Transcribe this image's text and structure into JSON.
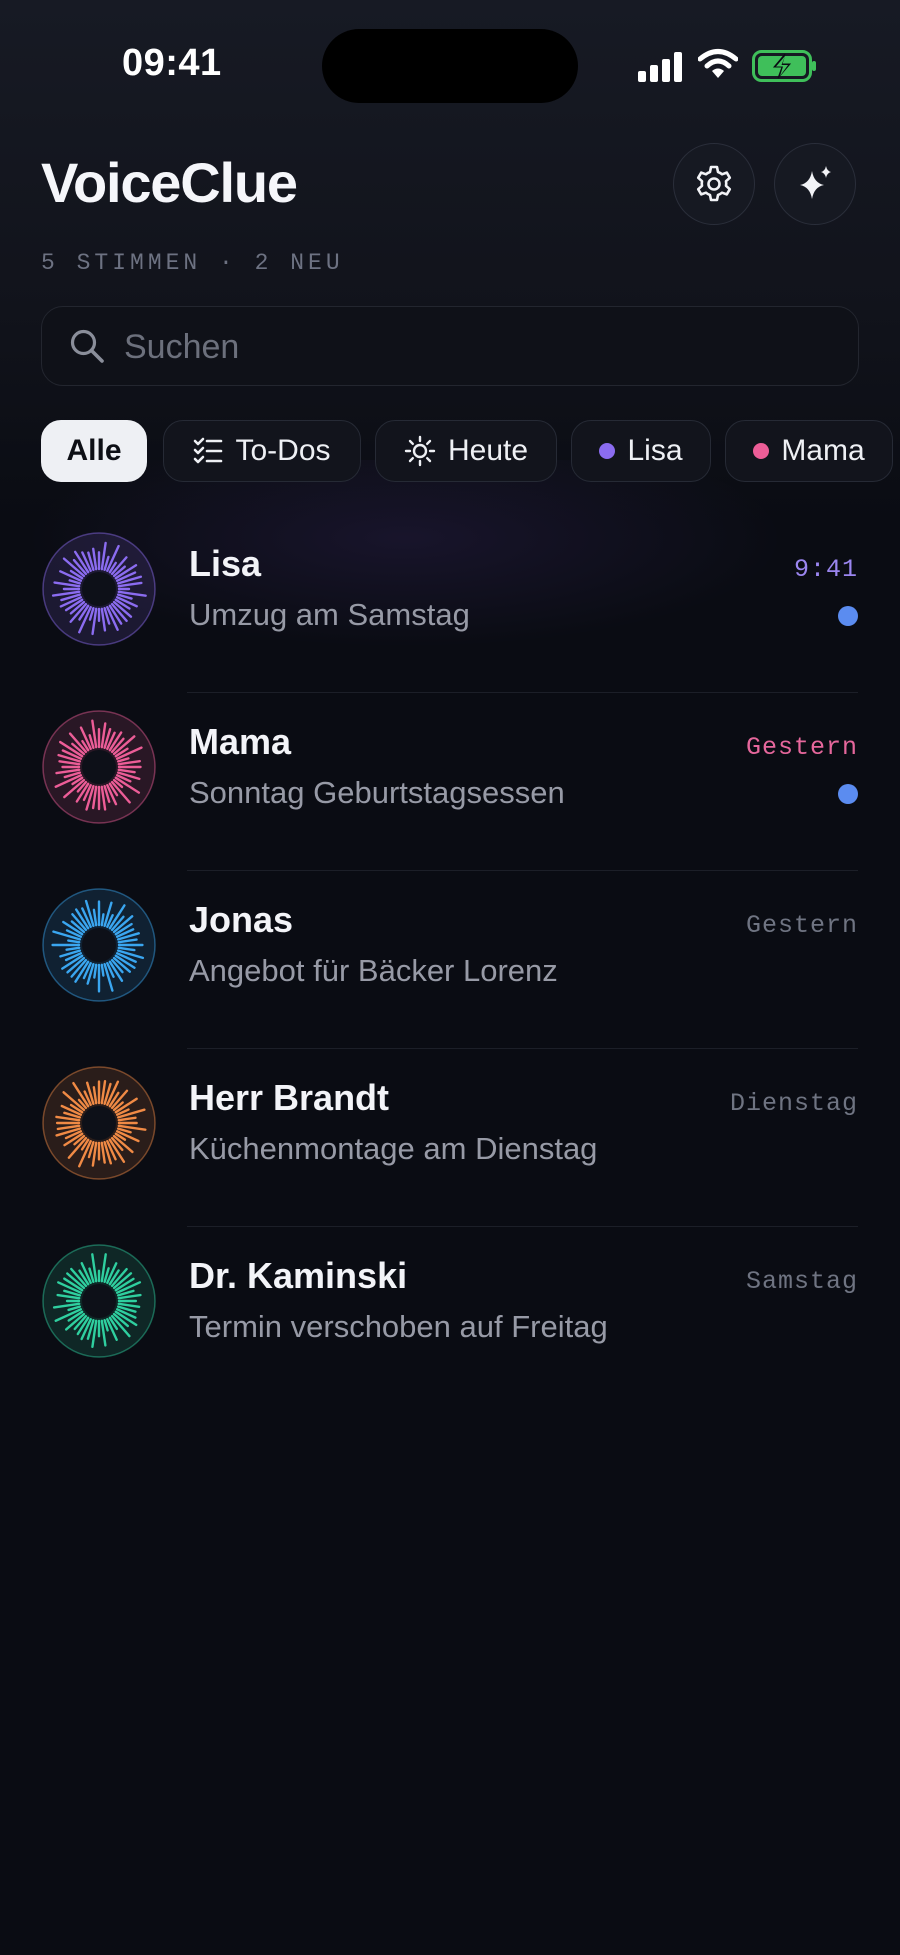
{
  "status_bar": {
    "time": "09:41"
  },
  "header": {
    "title": "VoiceClue",
    "subtitle": "5 STIMMEN · 2 NEU"
  },
  "search": {
    "placeholder": "Suchen",
    "value": ""
  },
  "filters": [
    {
      "label": "Alle",
      "active": true,
      "icon": "none"
    },
    {
      "label": "To-Dos",
      "active": false,
      "icon": "checklist-icon"
    },
    {
      "label": "Heute",
      "active": false,
      "icon": "sun-icon"
    },
    {
      "label": "Lisa",
      "active": false,
      "dot_color": "#8b6cf0"
    },
    {
      "label": "Mama",
      "active": false,
      "dot_color": "#ec5d97"
    }
  ],
  "conversations": [
    {
      "name": "Lisa",
      "preview": "Umzug am Samstag",
      "time": "9:41",
      "time_color": "#9b86f0",
      "unread": true,
      "color": "#8b6cf0"
    },
    {
      "name": "Mama",
      "preview": "Sonntag Geburtstagsessen",
      "time": "Gestern",
      "time_color": "#e6679c",
      "unread": true,
      "color": "#ec5d97"
    },
    {
      "name": "Jonas",
      "preview": "Angebot für Bäcker Lorenz",
      "time": "Gestern",
      "time_color": "#6f7482",
      "unread": false,
      "color": "#3aa6f0"
    },
    {
      "name": "Herr Brandt",
      "preview": "Küchenmontage am Dienstag",
      "time": "Dienstag",
      "time_color": "#6f7482",
      "unread": false,
      "color": "#f08a45"
    },
    {
      "name": "Dr. Kaminski",
      "preview": "Termin verschoben auf Freitag",
      "time": "Samstag",
      "time_color": "#6f7482",
      "unread": false,
      "color": "#2fcf9f"
    }
  ]
}
